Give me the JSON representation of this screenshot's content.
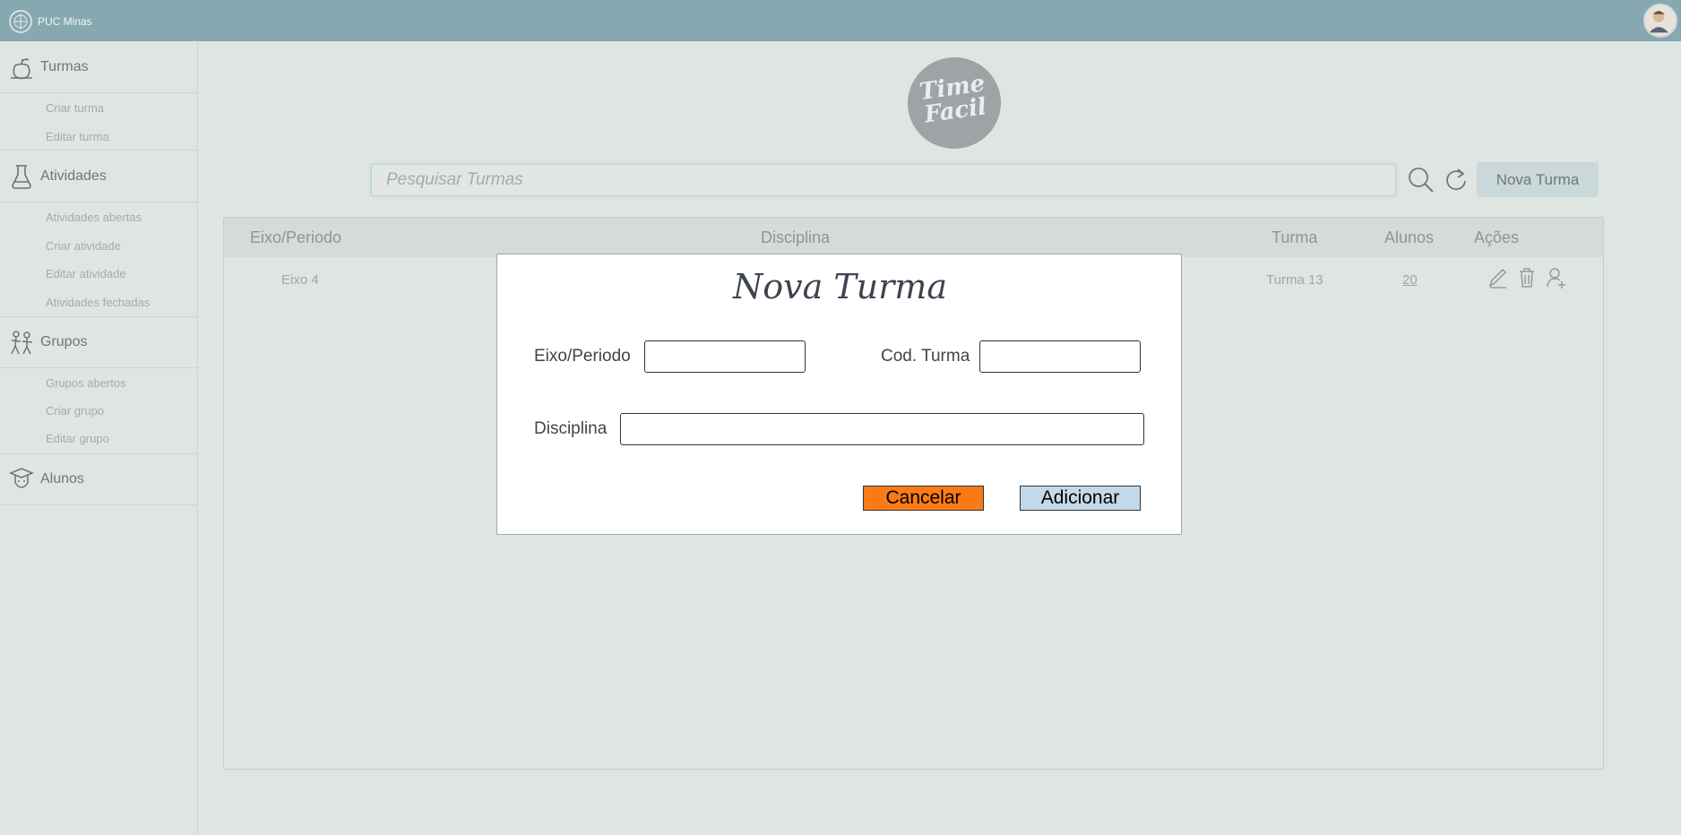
{
  "brand": {
    "name": "PUC Minas"
  },
  "sidebar": {
    "sections": [
      {
        "label": "Turmas",
        "icon": "apple-icon",
        "items": [
          "Criar turma",
          "Editar turma"
        ]
      },
      {
        "label": "Atividades",
        "icon": "flask-icon",
        "items": [
          "Atividades abertas",
          "Criar atividade",
          "Editar atividade",
          "Atividades fechadas"
        ]
      },
      {
        "label": "Grupos",
        "icon": "group-icon",
        "items": [
          "Grupos abertos",
          "Criar grupo",
          "Editar grupo"
        ]
      },
      {
        "label": "Alunos",
        "icon": "student-icon",
        "items": []
      }
    ]
  },
  "logo": {
    "line1": "Time",
    "line2": "Facil"
  },
  "search": {
    "placeholder": "Pesquisar Turmas",
    "value": ""
  },
  "toolbar": {
    "new_label": "Nova Turma"
  },
  "table": {
    "headers": [
      "Eixo/Periodo",
      "Disciplina",
      "Turma",
      "Alunos",
      "Ações"
    ],
    "rows": [
      {
        "eixo": "Eixo 4",
        "disciplina": "",
        "turma": "Turma 13",
        "alunos": "20",
        "actions": [
          "edit-icon",
          "trash-icon",
          "add-user-icon"
        ]
      }
    ]
  },
  "modal": {
    "title": "Nova Turma",
    "eixo_label": "Eixo/Periodo",
    "eixo_value": "",
    "cod_label": "Cod. Turma",
    "cod_value": "",
    "disciplina_label": "Disciplina",
    "disciplina_value": "",
    "cancel_label": "Cancelar",
    "add_label": "Adicionar"
  },
  "colors": {
    "topbar": "#86a9b1",
    "background": "#dfe5e1",
    "cancel": "#fa7b16",
    "add": "#c3d9ea"
  }
}
